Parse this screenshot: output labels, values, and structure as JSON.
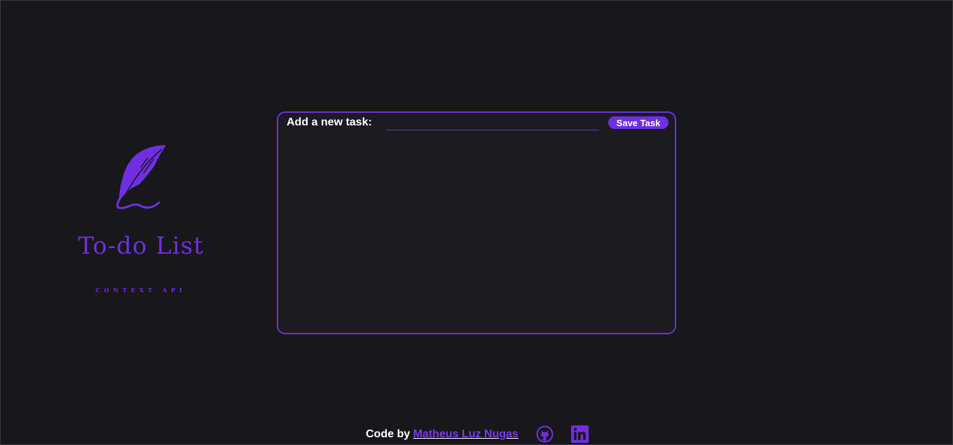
{
  "brand": {
    "title": "To-do List",
    "subtitle": "CONTEXT API",
    "logo_icon": "feather-quill-icon"
  },
  "task_form": {
    "label": "Add a new task:",
    "input_value": "",
    "input_placeholder": "",
    "save_label": "Save Task"
  },
  "tasks": [],
  "footer": {
    "credit_prefix": "Code by",
    "author_name": "Matheus Luz Nugas",
    "github_icon": "github-icon",
    "linkedin_icon": "linkedin-icon"
  },
  "colors": {
    "accent": "#6f2fe0",
    "background": "#18171b",
    "panel": "#1c1b20",
    "text": "#ffffff"
  }
}
